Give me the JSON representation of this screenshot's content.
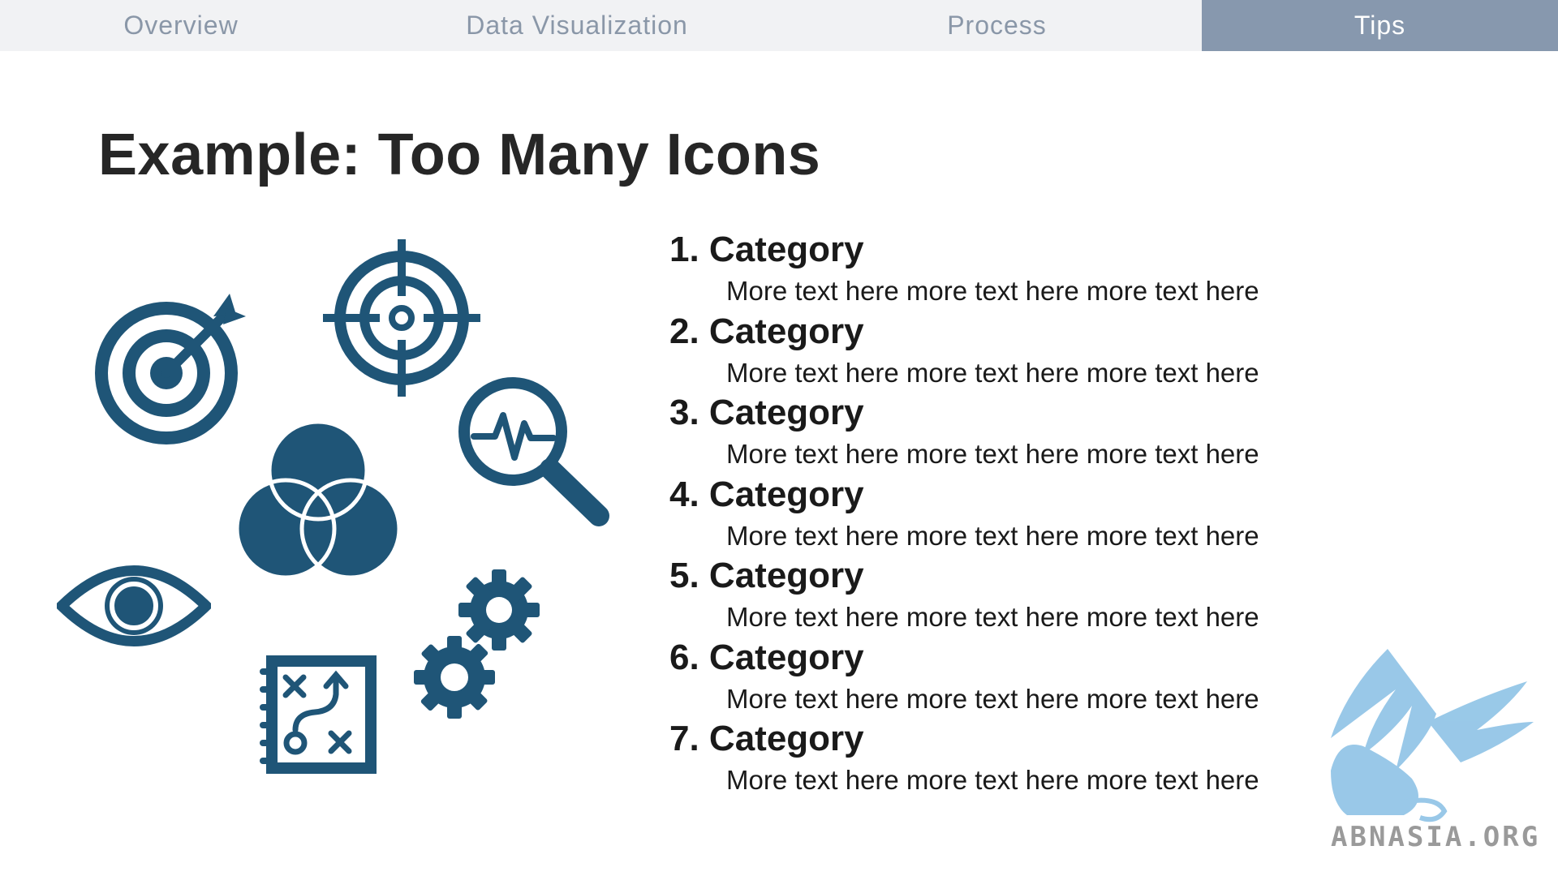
{
  "nav": {
    "tabs": [
      {
        "label": "Overview",
        "active": false
      },
      {
        "label": "Data Visualization",
        "active": false
      },
      {
        "label": "Process",
        "active": false
      },
      {
        "label": "Tips",
        "active": true
      }
    ]
  },
  "slide": {
    "title": "Example: Too Many Icons",
    "items": [
      {
        "heading": "1. Category",
        "text": "More text here more text here more text here"
      },
      {
        "heading": "2. Category",
        "text": "More text here more text here more text here"
      },
      {
        "heading": "3. Category",
        "text": "More text here more text here more text here"
      },
      {
        "heading": "4. Category",
        "text": "More text here more text here more text here"
      },
      {
        "heading": "5. Category",
        "text": "More text here more text here more text here"
      },
      {
        "heading": "6. Category",
        "text": "More text here more text here more text here"
      },
      {
        "heading": "7. Category",
        "text": "More text here more text here more text here"
      }
    ],
    "icons": [
      "target-arrow-icon",
      "crosshair-icon",
      "search-pulse-icon",
      "venn-diagram-icon",
      "eye-icon",
      "gears-icon",
      "strategy-board-icon"
    ]
  },
  "watermark": {
    "text": "ABNASIA.ORG"
  },
  "colors": {
    "icon": "#1f5577",
    "nav_bg": "#f1f2f4",
    "nav_active_bg": "#8798ae",
    "nav_text": "#8a97a8",
    "title": "#262626"
  }
}
